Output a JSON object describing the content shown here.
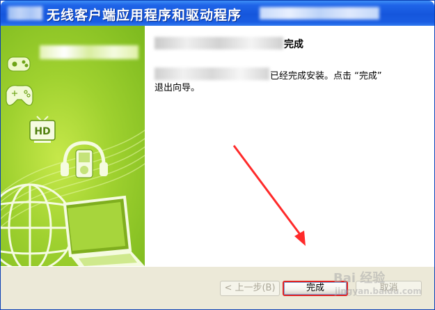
{
  "window": {
    "title": "无线客户端应用程序和驱动程序"
  },
  "content": {
    "heading_suffix": "完成",
    "body_line1": "已经完成安装。点击 “完成”",
    "body_line2": "退出向导。"
  },
  "buttons": {
    "back": "< 上一步(B)",
    "finish": "完成",
    "cancel": "取消"
  },
  "banner": {
    "icons": [
      "gamepad-icon",
      "controller-icon",
      "hd-tv-icon",
      "headphones-music-icon",
      "globe-icon",
      "laptop-icon"
    ],
    "hd_label": "HD"
  },
  "annotation": {
    "arrow_color": "#ff2a2a",
    "highlight_color": "#e02020"
  },
  "watermark": {
    "line1": "Bai 经验",
    "line2": "jingyan.baidu.com"
  },
  "colors": {
    "titlebar": "#1556dc",
    "banner_green": "#9fd12f",
    "buttonbar": "#ece9d8"
  }
}
